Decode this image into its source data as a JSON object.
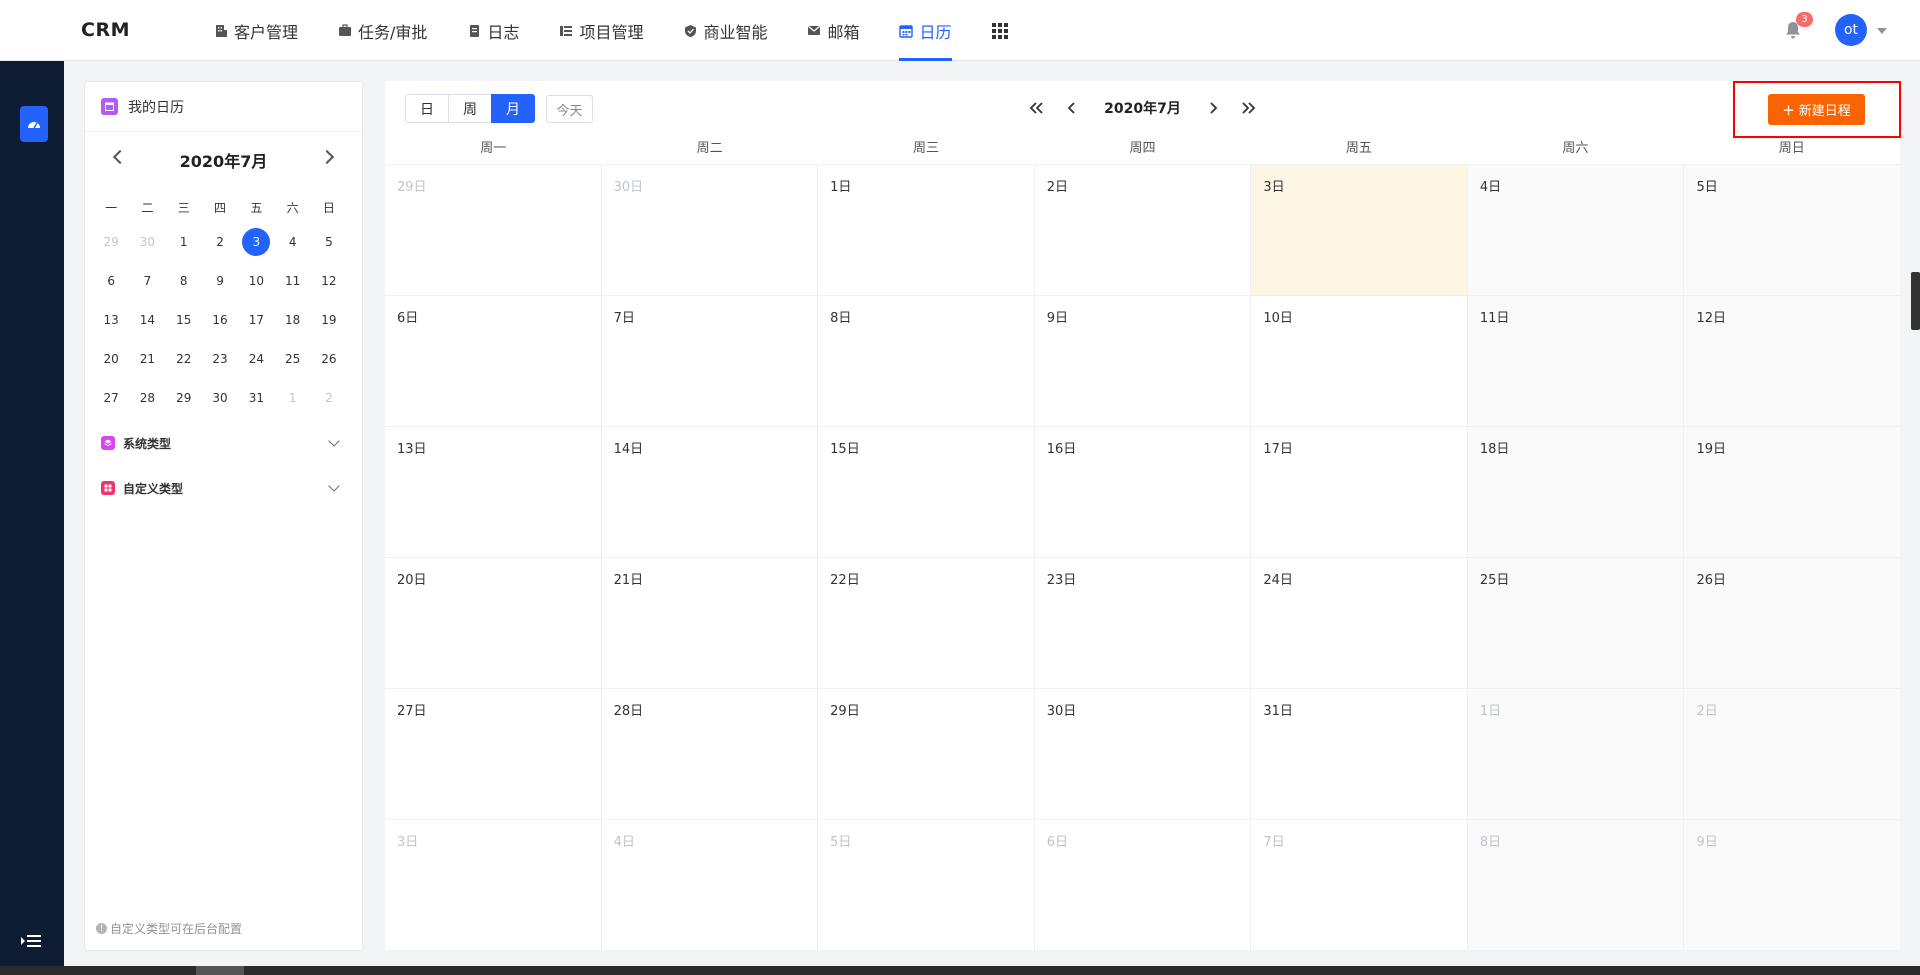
{
  "app": {
    "logo": "CRM"
  },
  "nav": {
    "items": [
      {
        "label": "客户管理",
        "icon": "building-icon"
      },
      {
        "label": "任务/审批",
        "icon": "briefcase-icon"
      },
      {
        "label": "日志",
        "icon": "document-icon"
      },
      {
        "label": "项目管理",
        "icon": "project-icon"
      },
      {
        "label": "商业智能",
        "icon": "shield-icon"
      },
      {
        "label": "邮箱",
        "icon": "mail-icon"
      },
      {
        "label": "日历",
        "icon": "calendar-icon",
        "active": true
      }
    ],
    "notifications": "3",
    "avatar": "ot",
    "accent": "#2362fb"
  },
  "sidebar_panel": {
    "title": "我的日历",
    "mini_title": "2020年7月",
    "weekdays": [
      "一",
      "二",
      "三",
      "四",
      "五",
      "六",
      "日"
    ],
    "weeks": [
      [
        "29",
        "30",
        "1",
        "2",
        "3",
        "4",
        "5"
      ],
      [
        "6",
        "7",
        "8",
        "9",
        "10",
        "11",
        "12"
      ],
      [
        "13",
        "14",
        "15",
        "16",
        "17",
        "18",
        "19"
      ],
      [
        "20",
        "21",
        "22",
        "23",
        "24",
        "25",
        "26"
      ],
      [
        "27",
        "28",
        "29",
        "30",
        "31",
        "1",
        "2"
      ]
    ],
    "selected_day": "3",
    "system_type": "系统类型",
    "custom_type": "自定义类型",
    "footnote": "自定义类型可在后台配置"
  },
  "calendar": {
    "views": [
      "日",
      "周",
      "月"
    ],
    "active_view": "月",
    "today": "今天",
    "title": "2020年7月",
    "new_button": "新建日程",
    "new_button_color": "#fa6400",
    "weekdays": [
      "周一",
      "周二",
      "周三",
      "周四",
      "周五",
      "周六",
      "周日"
    ],
    "weeks": [
      [
        "29日",
        "30日",
        "1日",
        "2日",
        "3日",
        "4日",
        "5日"
      ],
      [
        "6日",
        "7日",
        "8日",
        "9日",
        "10日",
        "11日",
        "12日"
      ],
      [
        "13日",
        "14日",
        "15日",
        "16日",
        "17日",
        "18日",
        "19日"
      ],
      [
        "20日",
        "21日",
        "22日",
        "23日",
        "24日",
        "25日",
        "26日"
      ],
      [
        "27日",
        "28日",
        "29日",
        "30日",
        "31日",
        "1日",
        "2日"
      ],
      [
        "3日",
        "4日",
        "5日",
        "6日",
        "7日",
        "8日",
        "9日"
      ]
    ],
    "today_cell": "3日"
  }
}
